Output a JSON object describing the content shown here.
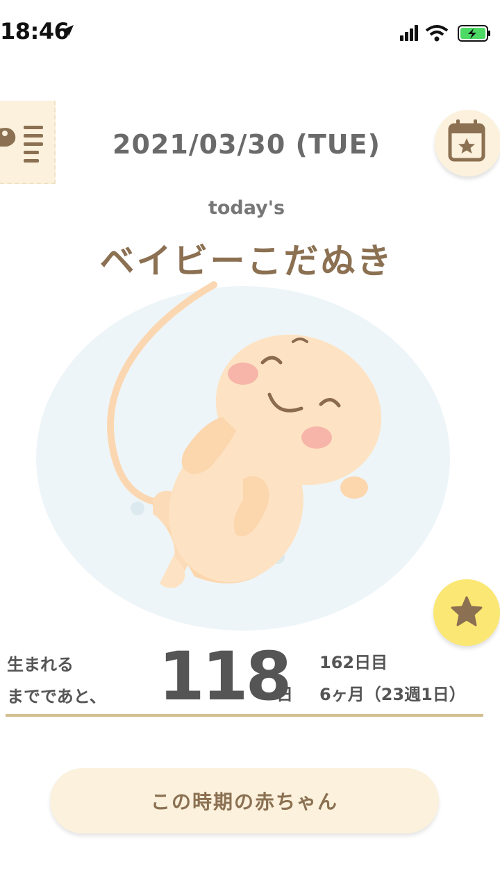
{
  "status_bar": {
    "time": "18:46",
    "icons": [
      "location-arrow-icon",
      "cellular-signal-icon",
      "wifi-icon",
      "battery-charging-icon"
    ]
  },
  "header": {
    "date": "2021/03/30 (TUE)",
    "menu_icon": "baby-list-menu-icon",
    "calendar_icon": "calendar-star-icon"
  },
  "today": {
    "label": "today's",
    "baby_name": "ベイビーこだぬき",
    "illustration": "fetus-illustration"
  },
  "favorite": {
    "icon": "star-icon"
  },
  "countdown": {
    "label_line1": "生まれる",
    "label_line2": "までであと、",
    "days_remaining": "118",
    "days_unit": "日",
    "day_count": "162日目",
    "month_week": "6ヶ月（23週1日）"
  },
  "actions": {
    "baby_period_button": "この時期の赤ちゃん"
  },
  "colors": {
    "cream": "#fbf1dc",
    "brown": "#8b7052",
    "star_yellow": "#fbe773",
    "divider_gold": "#d4bf92",
    "bubble_blue": "#eef5f8",
    "skin": "#fde3c3"
  }
}
